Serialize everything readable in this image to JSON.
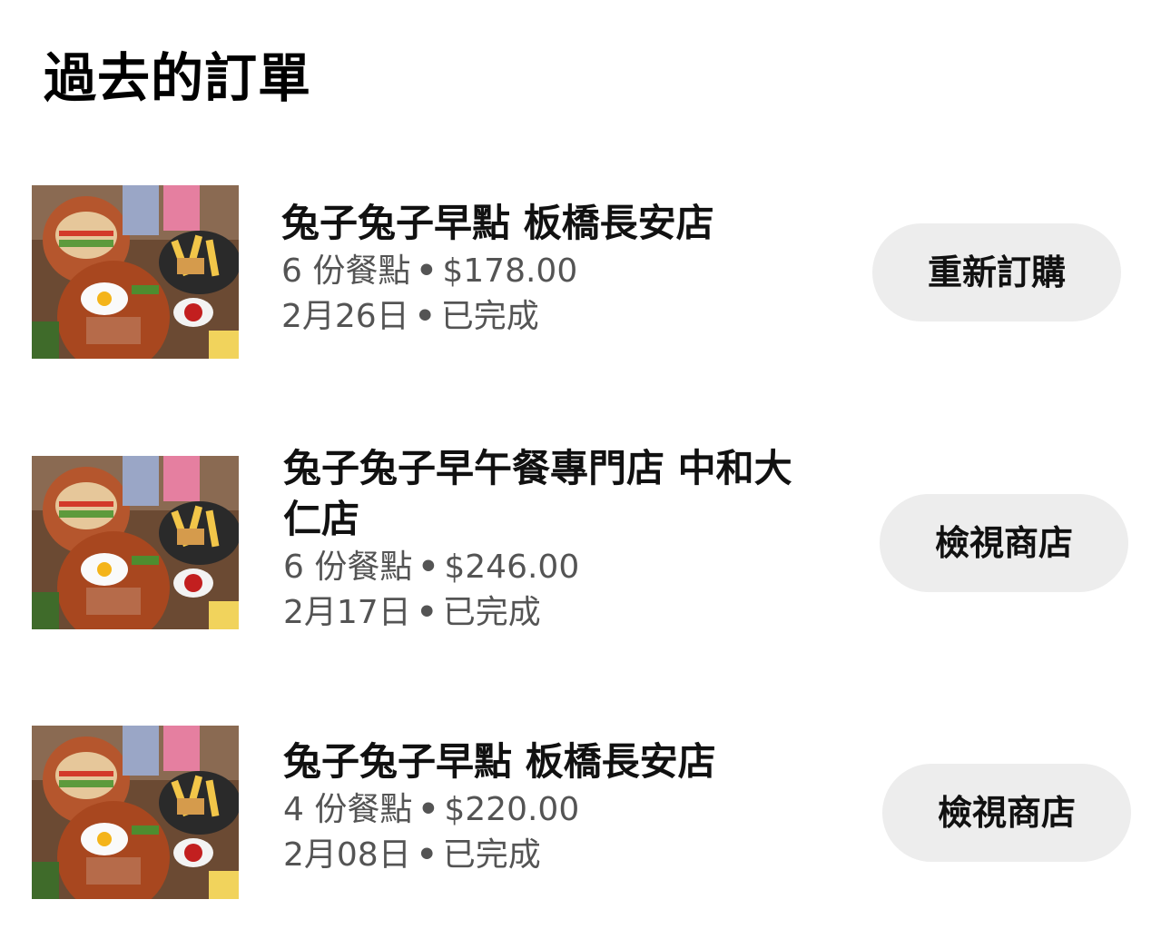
{
  "page": {
    "title": "過去的訂單"
  },
  "orders": [
    {
      "store_name": "兔子兔子早點 板橋長安店",
      "item_count": "6 份餐點",
      "price": "$178.00",
      "date": "2月26日",
      "status": "已完成",
      "action_label": "重新訂購"
    },
    {
      "store_name": "兔子兔子早午餐專門店 中和大仁店",
      "item_count": "6 份餐點",
      "price": "$246.00",
      "date": "2月17日",
      "status": "已完成",
      "action_label": "檢視商店"
    },
    {
      "store_name": "兔子兔子早點 板橋長安店",
      "item_count": "4 份餐點",
      "price": "$220.00",
      "date": "2月08日",
      "status": "已完成",
      "action_label": "檢視商店"
    }
  ],
  "separator": "•",
  "icons": {
    "thumbnail": "food-photo-icon"
  }
}
